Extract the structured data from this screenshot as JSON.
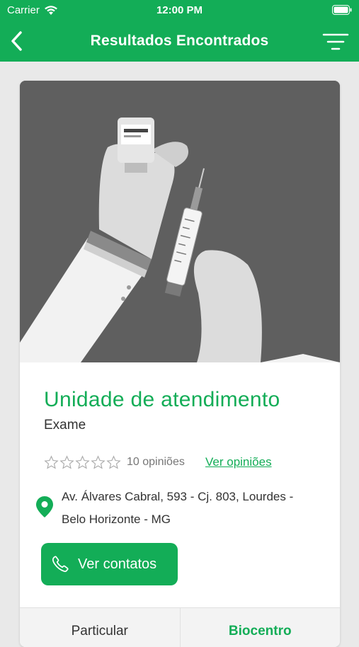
{
  "status_bar": {
    "carrier": "Carrier",
    "time": "12:00 PM"
  },
  "nav": {
    "title": "Resultados Encontrados",
    "back_icon": "chevron-left-icon",
    "filter_icon": "filter-icon"
  },
  "unit": {
    "title": "Unidade de atendimento",
    "subtitle": "Exame",
    "rating": 0,
    "max_rating": 5,
    "reviews_count": "10 opiniões",
    "see_reviews": "Ver opiniões",
    "address_line1": "Av. Álvares Cabral, 593 - Cj. 803, Lourdes -",
    "address_line2": "Belo Horizonte - MG",
    "contact_button": "Ver contatos"
  },
  "tabs": [
    {
      "label": "Particular",
      "active": false
    },
    {
      "label": "Biocentro",
      "active": true
    }
  ],
  "colors": {
    "brand": "#13ad57",
    "hero_bg": "#5f5f5f"
  }
}
